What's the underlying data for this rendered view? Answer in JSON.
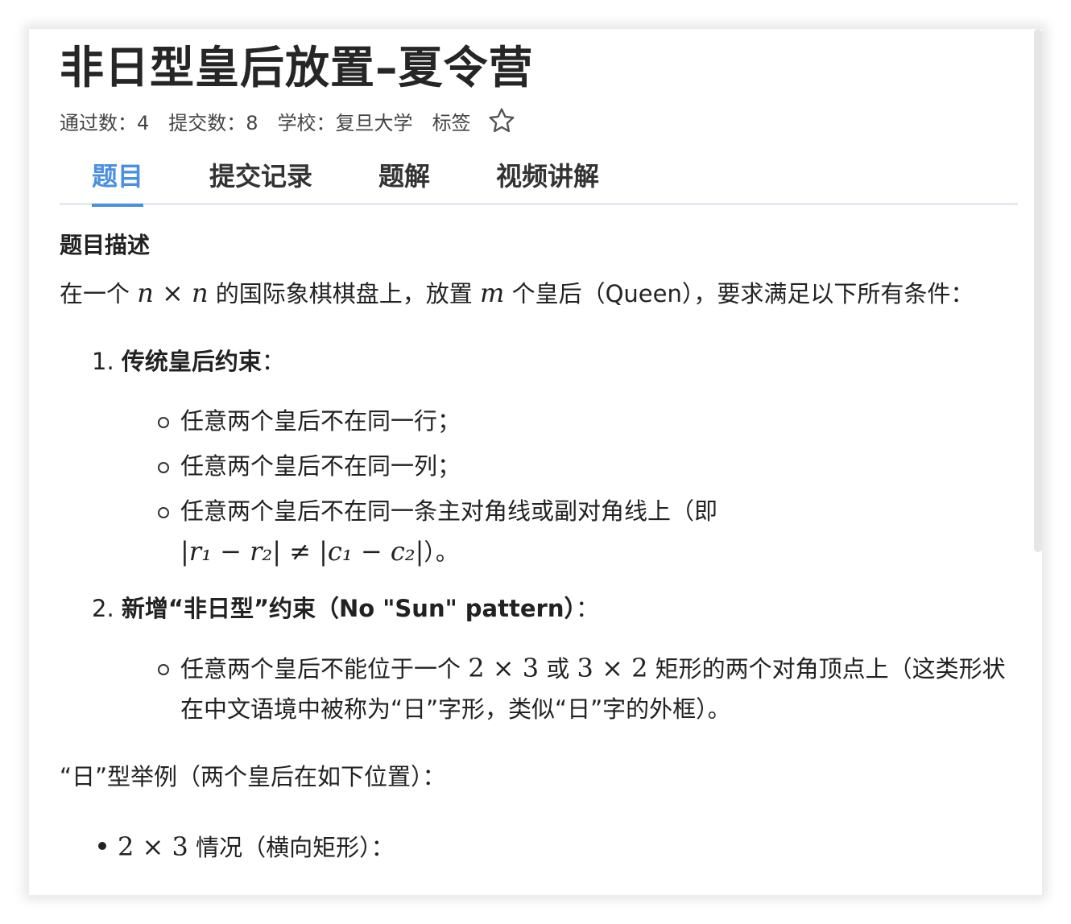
{
  "title": "非日型皇后放置–夏令营",
  "meta": {
    "passed": "通过数：4",
    "submitted": "提交数：8",
    "school": "学校：复旦大学",
    "tags": "标签"
  },
  "tabs": [
    "题目",
    "提交记录",
    "题解",
    "视频讲解"
  ],
  "section_title": "题目描述",
  "intro": {
    "p1": "在一个 ",
    "m1": "n × n",
    "p2": " 的国际象棋棋盘上，放置 ",
    "m2": "m",
    "p3": " 个皇后（Queen），要求满足以下所有条件："
  },
  "rule1": {
    "num": "1. ",
    "title": "传统皇后约束",
    "colon": "：",
    "items": [
      "任意两个皇后不在同一行；",
      "任意两个皇后不在同一列；",
      "任意两个皇后不在同一条主对角线或副对角线上（即"
    ],
    "formula": "|r₁ − r₂| ≠ |c₁ − c₂|",
    "formula_end": "）。"
  },
  "rule2": {
    "num": "2. ",
    "title": "新增“非日型”约束（No \"Sun\" pattern）",
    "colon": "：",
    "item_a": "任意两个皇后不能位于一个 ",
    "m_a": "2 × 3",
    "item_b": " 或 ",
    "m_b": "3 × 2",
    "item_c": " 矩形的两个对角顶点上（这类形状在中文语境中被称为“日”字形，类似“日”字的外框）。"
  },
  "example_title": "“日”型举例（两个皇后在如下位置）：",
  "bullet1": {
    "m": "2 × 3",
    "text": " 情况（横向矩形）："
  },
  "colors": {
    "accent": "#4a90e2",
    "tab_border": "#e5e9f0"
  },
  "icons": {
    "star": "star-outline-icon"
  }
}
